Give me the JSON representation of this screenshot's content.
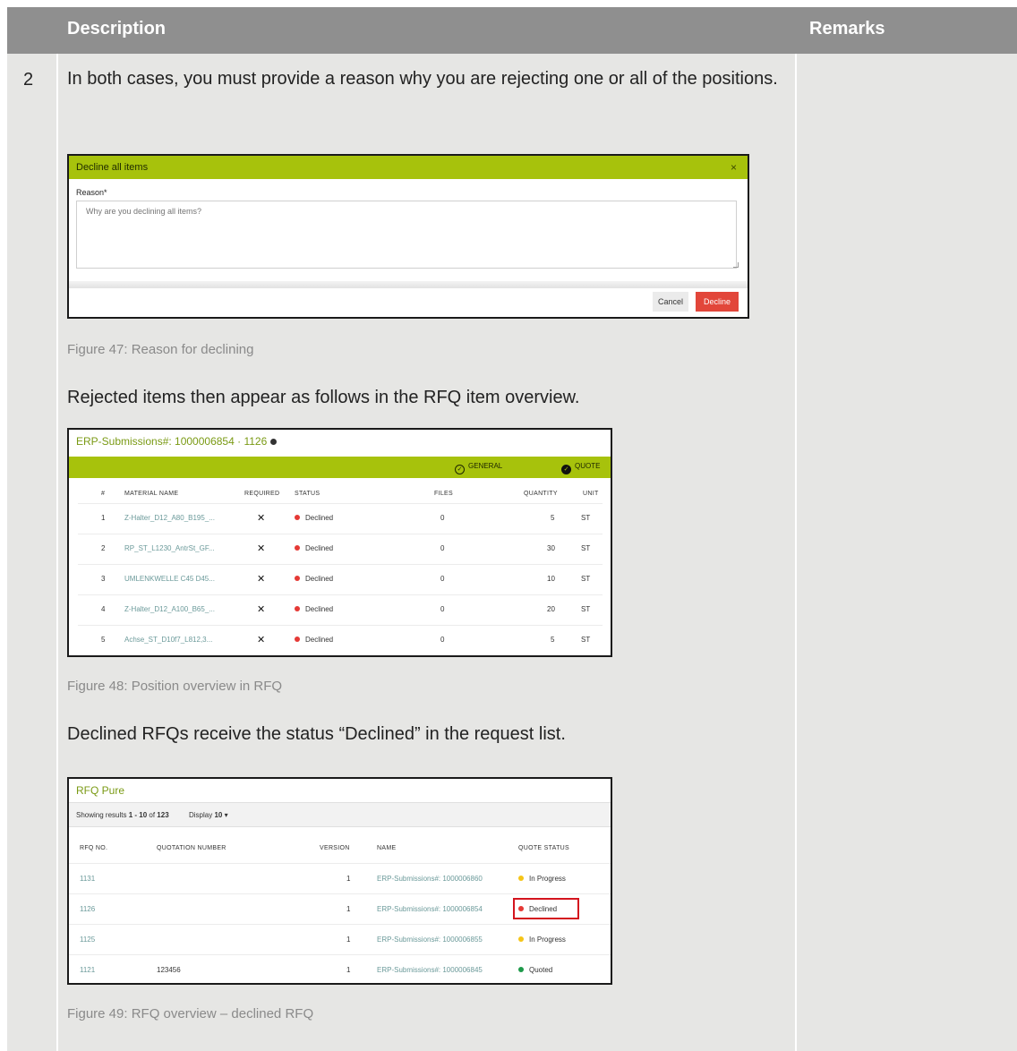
{
  "header": {
    "description": "Description",
    "remarks": "Remarks"
  },
  "row": {
    "number": "2",
    "text1": "In both cases, you must provide a reason why you are rejecting one or all of the positions.",
    "caption1": "Figure 47: Reason for declining",
    "text2": "Rejected items then appear as follows in the RFQ item overview.",
    "caption2": "Figure 48: Position overview in RFQ",
    "text3": "Declined RFQs receive the status “Declined” in the request list.",
    "caption3": "Figure 49: RFQ overview – declined RFQ"
  },
  "dialog": {
    "title": "Decline all items",
    "close": "×",
    "reason_label": "Reason*",
    "reason_placeholder": "Why are you declining all items?",
    "cancel": "Cancel",
    "decline": "Decline"
  },
  "overview": {
    "title": "ERP-Submissions#: 1000006854 · 1126",
    "tab_general": "GENERAL",
    "tab_quote": "QUOTE",
    "columns": [
      "#",
      "MATERIAL NAME",
      "REQUIRED",
      "STATUS",
      "FILES",
      "QUANTITY",
      "UNIT"
    ],
    "required_mark": "✕",
    "rows": [
      {
        "num": "1",
        "name": "Z-Halter_D12_A80_B195_...",
        "status": "Declined",
        "files": "0",
        "qty": "5",
        "unit": "ST"
      },
      {
        "num": "2",
        "name": "RP_ST_L1230_AntrSt_GF...",
        "status": "Declined",
        "files": "0",
        "qty": "30",
        "unit": "ST"
      },
      {
        "num": "3",
        "name": "UMLENKWELLE C45 D45...",
        "status": "Declined",
        "files": "0",
        "qty": "10",
        "unit": "ST"
      },
      {
        "num": "4",
        "name": "Z-Halter_D12_A100_B65_...",
        "status": "Declined",
        "files": "0",
        "qty": "20",
        "unit": "ST"
      },
      {
        "num": "5",
        "name": "Achse_ST_D10f7_L812,3...",
        "status": "Declined",
        "files": "0",
        "qty": "5",
        "unit": "ST"
      }
    ]
  },
  "rfq_list": {
    "title": "RFQ Pure",
    "showing_prefix": "Showing results ",
    "showing_range": "1 - 10",
    "showing_of": " of ",
    "showing_total": "123",
    "display_label": "Display",
    "display_value": "10",
    "columns": [
      "RFQ NO.",
      "QUOTATION NUMBER",
      "VERSION",
      "NAME",
      "QUOTE STATUS"
    ],
    "rows": [
      {
        "rfq": "1131",
        "quotation": "",
        "version": "1",
        "name": "ERP-Submissions#: 1000006860",
        "status": "In Progress",
        "status_color": "#f5c518"
      },
      {
        "rfq": "1126",
        "quotation": "",
        "version": "1",
        "name": "ERP-Submissions#: 1000006854",
        "status": "Declined",
        "status_color": "#e53935"
      },
      {
        "rfq": "1125",
        "quotation": "",
        "version": "1",
        "name": "ERP-Submissions#: 1000006855",
        "status": "In Progress",
        "status_color": "#f5c518"
      },
      {
        "rfq": "1121",
        "quotation": "123456",
        "version": "1",
        "name": "ERP-Submissions#: 1000006845",
        "status": "Quoted",
        "status_color": "#1e9a4a"
      }
    ]
  },
  "colors": {
    "accent_green": "#a7c20c",
    "declined": "#e53935",
    "decline_button": "#e2463a",
    "header_gray": "#8f8f8f",
    "cell_gray": "#e6e6e4"
  }
}
